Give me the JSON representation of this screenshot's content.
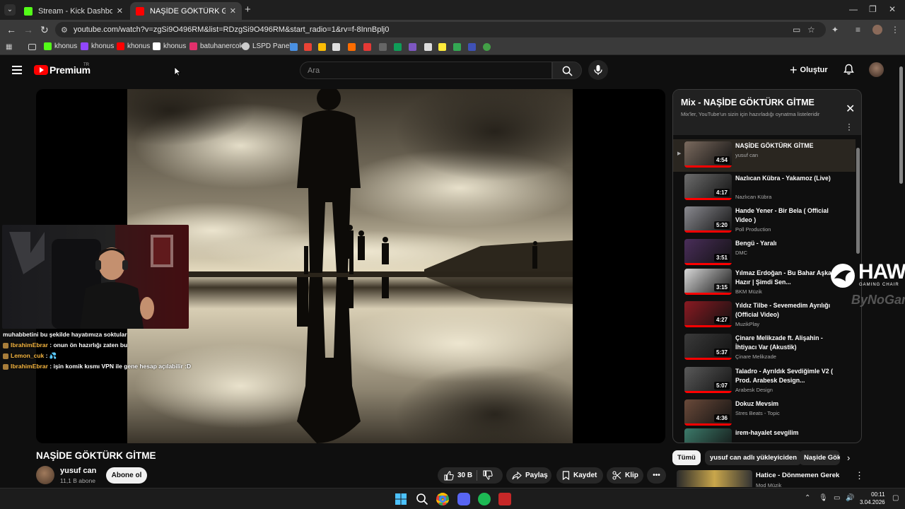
{
  "browser": {
    "tabs": [
      {
        "title": "Stream - Kick Dashboard",
        "favicon_color": "#53fc18",
        "active": false
      },
      {
        "title": "NAŞİDE GÖKTÜRK GİTME - You",
        "favicon_color": "#ff0000",
        "active": true
      }
    ],
    "url": "youtube.com/watch?v=zgSi9O496RM&list=RDzgSi9O496RM&start_radio=1&rv=f-8InnBplj0",
    "bookmarks": [
      {
        "label": "khonus",
        "icon_color": "#53fc18"
      },
      {
        "label": "khonus",
        "icon_color": "#9146ff"
      },
      {
        "label": "khonus",
        "icon_color": "#ff0000"
      },
      {
        "label": "khonus",
        "icon_color": "#ffffff"
      },
      {
        "label": "batuhanercok",
        "icon_color": "#e1306c"
      },
      {
        "label": "LSPD Panel",
        "icon_color": "#cccccc"
      }
    ]
  },
  "youtube": {
    "logo_text": "Premium",
    "logo_region": "TR",
    "search_placeholder": "Ara",
    "create_label": "Oluştur"
  },
  "video": {
    "title": "NAŞİDE GÖKTÜRK GİTME",
    "channel": "yusuf can",
    "subscribers": "11,1 B abone",
    "subscribe_label": "Abone ol",
    "likes": "30 B",
    "share_label": "Paylaş",
    "save_label": "Kaydet",
    "clip_label": "Klip"
  },
  "overlay": {
    "chat": [
      {
        "user": "",
        "text": "muhabbetini bu şekilde hayatımıza soktular"
      },
      {
        "user": "IbrahimEbrar",
        "text": ": onun ön hazırlığı zaten bu"
      },
      {
        "user": "Lemon_cuk",
        "text": ":"
      },
      {
        "user": "IbrahimEbrar",
        "text": ": işin komik kısmı VPN ile gene hesap açılabilir :D"
      }
    ],
    "sponsor": "HAWK",
    "sponsor_sub": "GAMING CHAIR",
    "sponsor2": "ByNoGame"
  },
  "mix": {
    "title": "Mix - NAŞİDE GÖKTÜRK GİTME",
    "subtitle": "Mix'ler, YouTube'un sizin için hazırladığı oynatma listeleridir",
    "items": [
      {
        "title": "NAŞİDE GÖKTÜRK GİTME",
        "channel": "yusuf can",
        "duration": "4:54",
        "thumb": "#7a6a5e"
      },
      {
        "title": "Nazlıcan Kübra - Yakamoz (Live)",
        "channel": "Nazlıcan Kübra",
        "duration": "4:17",
        "thumb": "#6c6c6c"
      },
      {
        "title": "Hande Yener - Bir Bela ( Official Video )",
        "channel": "Poll Production",
        "duration": "5:20",
        "thumb": "#8a8a90"
      },
      {
        "title": "Bengü - Yaralı",
        "channel": "DMC",
        "duration": "3:51",
        "thumb": "#4a2e5a"
      },
      {
        "title": "Yılmaz Erdoğan - Bu Bahar Aşka Hazır | Şimdi Sen...",
        "channel": "BKM Müzik",
        "duration": "3:15",
        "thumb": "#d8d8d8"
      },
      {
        "title": "Yıldız Tilbe - Sevemedim Ayrılığı (Official Video)",
        "channel": "MuzikPlay",
        "duration": "4:27",
        "thumb": "#8a1a22"
      },
      {
        "title": "Çinare Melikzade ft. Alişahin - İhtiyacı Var (Akustik)",
        "channel": "Çinare Melikzade",
        "duration": "5:37",
        "thumb": "#3a3a3a"
      },
      {
        "title": "Taladro - Ayrıldık Sevdiğimle V2 ( Prod. Arabesk Design...",
        "channel": "Arabesk Design",
        "duration": "5:07",
        "thumb": "#5a5a5a"
      },
      {
        "title": "Dokuz Mevsim",
        "channel": "Stres Beats - Topic",
        "duration": "4:36",
        "thumb": "#6a4a3a"
      },
      {
        "title": "irem-hayalet sevgilim",
        "channel": "",
        "duration": "",
        "thumb": "#3c7a6a"
      }
    ]
  },
  "chips": [
    "Tümü",
    "yusuf can adlı yükleyiciden",
    "Naşide Gök"
  ],
  "recommended": {
    "title": "Hatice - Dönmemen Gerek",
    "channel": "Mod Müzik"
  },
  "taskbar": {
    "time": "00:11",
    "date": "3.04.2026"
  }
}
